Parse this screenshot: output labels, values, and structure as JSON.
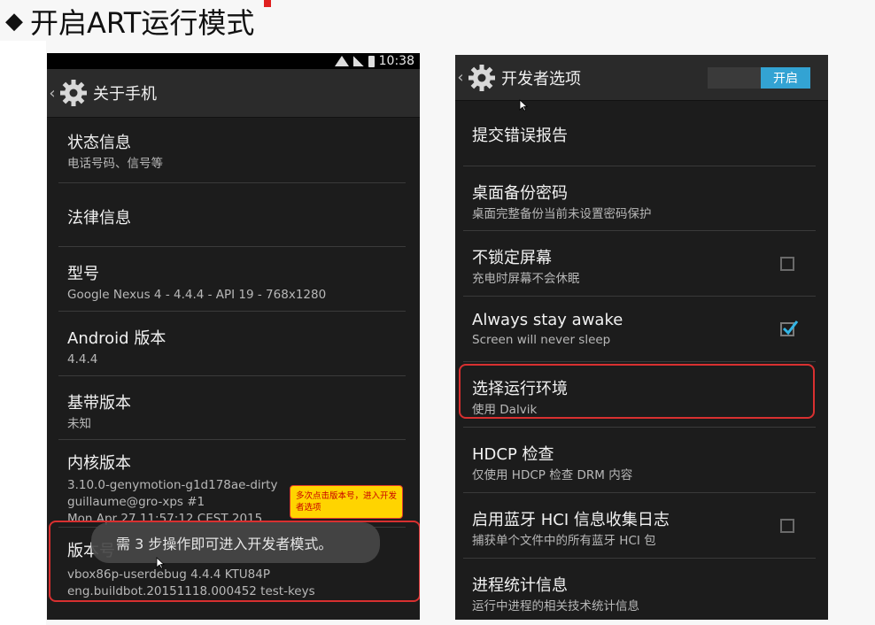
{
  "slide": {
    "title": "开启ART运行模式"
  },
  "left_screen": {
    "status_time": "10:38",
    "header_title": "关于手机",
    "items": [
      {
        "title": "状态信息",
        "summary": "电话号码、信号等"
      },
      {
        "title": "法律信息",
        "summary": ""
      },
      {
        "title": "型号",
        "summary": "Google Nexus 4 - 4.4.4 - API 19 - 768x1280"
      },
      {
        "title": "Android 版本",
        "summary": "4.4.4"
      },
      {
        "title": "基带版本",
        "summary": "未知"
      },
      {
        "title": "内核版本",
        "summary_lines": [
          "3.10.0-genymotion-g1d178ae-dirty",
          "guillaume@gro-xps #1",
          "Mon Apr 27 11:57:12 CEST 2015"
        ]
      },
      {
        "title": "版本号",
        "summary_lines": [
          "vbox86p-userdebug 4.4.4 KTU84P",
          "eng.buildbot.20151118.000452 test-keys"
        ]
      }
    ],
    "toast": "需 3 步操作即可进入开发者模式。",
    "callout": "多次点击版本号，进入开发者选项"
  },
  "right_screen": {
    "header_title": "开发者选项",
    "master_switch": "开启",
    "items": [
      {
        "title": "提交错误报告",
        "summary": ""
      },
      {
        "title": "桌面备份密码",
        "summary": "桌面完整备份当前未设置密码保护"
      },
      {
        "title": "不锁定屏幕",
        "summary": "充电时屏幕不会休眠",
        "checked": false
      },
      {
        "title": "Always stay awake",
        "summary": "Screen will never sleep",
        "checked": true
      },
      {
        "title": "选择运行环境",
        "summary": "使用 Dalvik"
      },
      {
        "title": "HDCP 检查",
        "summary": "仅使用 HDCP 检查 DRM 内容"
      },
      {
        "title": "启用蓝牙 HCI 信息收集日志",
        "summary": "捕获单个文件中的所有蓝牙 HCI 包",
        "checked": false
      },
      {
        "title": "进程统计信息",
        "summary": "运行中进程的相关技术统计信息"
      }
    ]
  },
  "colors": {
    "accent": "#33a3d3",
    "highlight": "#d83030",
    "callout_bg": "#ffd400",
    "callout_text": "#c80000"
  },
  "icons": [
    "gear-icon",
    "back-chevron-icon",
    "wifi-icon",
    "signal-icon",
    "battery-icon",
    "check-icon",
    "cursor-icon"
  ]
}
